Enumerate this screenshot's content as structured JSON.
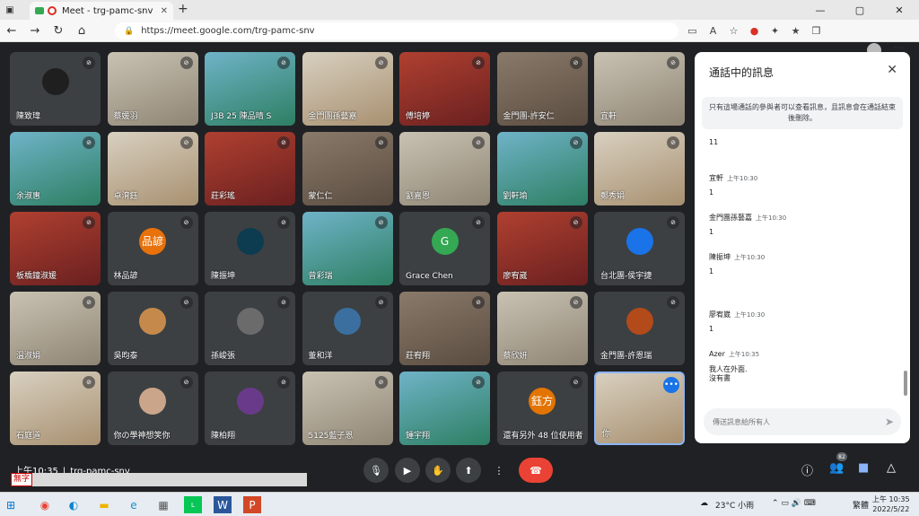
{
  "browser": {
    "tab_title": "Meet - trg-pamc-snv",
    "url": "https://meet.google.com/trg-pamc-snv"
  },
  "participants": [
    {
      "name": "陳致瑋",
      "type": "avatar",
      "color": "#1f1f1f"
    },
    {
      "name": "蔡媛羽",
      "type": "video"
    },
    {
      "name": "J3B 25 陳品晴 S",
      "type": "video"
    },
    {
      "name": "金門團孫藝嘉",
      "type": "video"
    },
    {
      "name": "傅培婷",
      "type": "video"
    },
    {
      "name": "金門團-許安仁",
      "type": "video"
    },
    {
      "name": "宜軒",
      "type": "video"
    },
    {
      "name": "余淑惠",
      "type": "video"
    },
    {
      "name": "卓淯鈺",
      "type": "video"
    },
    {
      "name": "莊彩瑤",
      "type": "video"
    },
    {
      "name": "蒙仁仁",
      "type": "video"
    },
    {
      "name": "劉嘉恩",
      "type": "video"
    },
    {
      "name": "劉軒瑜",
      "type": "video"
    },
    {
      "name": "鄭秀娟",
      "type": "video"
    },
    {
      "name": "板橋鐘淑媛",
      "type": "video"
    },
    {
      "name": "林品諺",
      "type": "avatar",
      "initials": "品諺",
      "color": "#e8710a"
    },
    {
      "name": "陳振坤",
      "type": "avatar",
      "color": "#0d3b4f"
    },
    {
      "name": "曾彩瑞",
      "type": "video"
    },
    {
      "name": "Grace Chen",
      "type": "avatar",
      "initials": "G",
      "color": "#34a853"
    },
    {
      "name": "廖宥崴",
      "type": "video"
    },
    {
      "name": "台北團-侯宇捷",
      "type": "avatar",
      "color": "#1a73e8"
    },
    {
      "name": "溫淑娟",
      "type": "video"
    },
    {
      "name": "吳昀泰",
      "type": "avatar",
      "color": "#c58a4b"
    },
    {
      "name": "孫峻張",
      "type": "avatar",
      "color": "#6b6b6b"
    },
    {
      "name": "董和洋",
      "type": "avatar",
      "color": "#3b6fa0"
    },
    {
      "name": "莊宥翔",
      "type": "video"
    },
    {
      "name": "蔡欣妍",
      "type": "video"
    },
    {
      "name": "金門團-許恩瑞",
      "type": "avatar",
      "color": "#b34a1a"
    },
    {
      "name": "石庭道",
      "type": "video"
    },
    {
      "name": "你の學神想笑你",
      "type": "avatar",
      "color": "#caa58a"
    },
    {
      "name": "陳柏翔",
      "type": "avatar",
      "color": "#6a3a8a"
    },
    {
      "name": "5125藍子恩",
      "type": "video"
    },
    {
      "name": "鍾宇翔",
      "type": "video"
    },
    {
      "name": "還有另外 48 位使用者",
      "type": "others",
      "initials": "鈺方"
    },
    {
      "name": "你",
      "type": "self"
    }
  ],
  "chat": {
    "title": "通話中的訊息",
    "notice": "只有這場通話的參與者可以查看訊息，且訊息會在通話結束後刪除。",
    "messages": [
      {
        "sender": "",
        "time": "",
        "text": "11"
      },
      {
        "sender": "宜軒",
        "time": "上午10:30",
        "text": "1"
      },
      {
        "sender": "金門團孫藝嘉",
        "time": "上午10:30",
        "text": "1"
      },
      {
        "sender": "陳振坤",
        "time": "上午10:30",
        "text": "1"
      },
      {
        "sender": "廖宥崴",
        "time": "上午10:30",
        "text": "1"
      },
      {
        "sender": "Azer",
        "time": "上午10:35",
        "text": "我人在外面."
      },
      {
        "sender": "",
        "time": "",
        "text": "沒有書"
      }
    ],
    "input_placeholder": "傳送訊息給所有人"
  },
  "meeting": {
    "time": "上午10:35",
    "separator": "|",
    "code": "trg-pamc-snv",
    "caption_label": "無字",
    "people_count": "82"
  },
  "taskbar": {
    "weather": "23°C 小雨",
    "input_lang": "繁體",
    "clock_time": "上午 10:35",
    "clock_date": "2022/5/22"
  }
}
